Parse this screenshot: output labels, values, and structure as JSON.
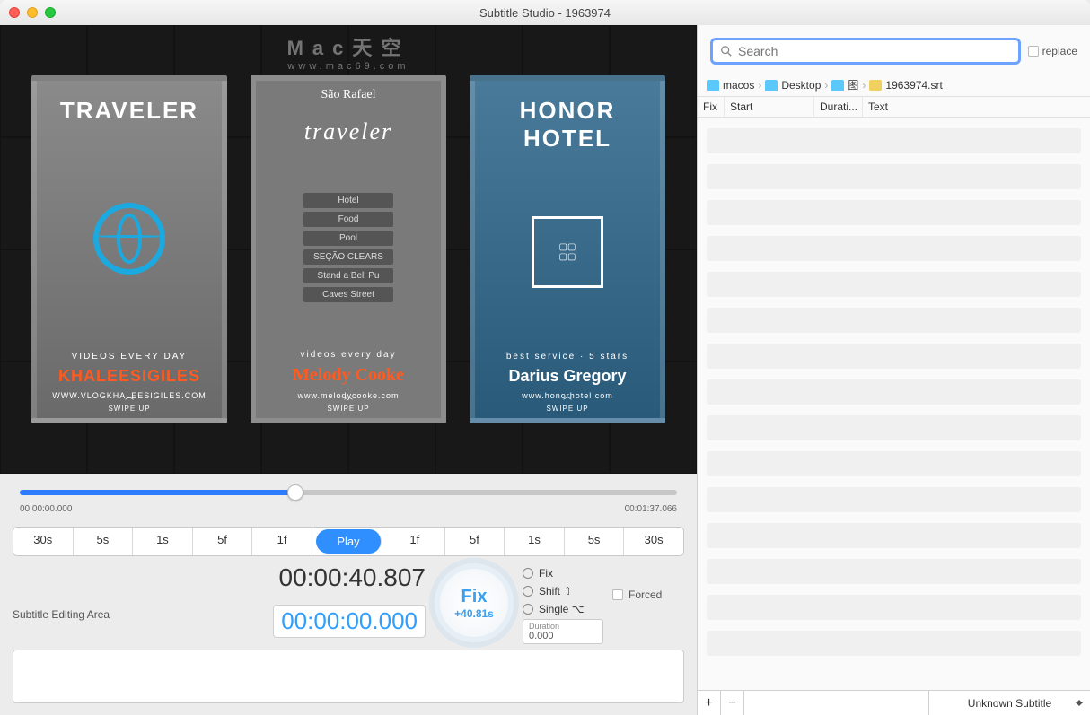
{
  "window": {
    "title": "Subtitle Studio - 1963974"
  },
  "watermark": {
    "line1": "Mac天空",
    "line2": "www.mac69.com"
  },
  "preview": {
    "cards": [
      {
        "title": "TRAVELER",
        "sub": "VIDEOS EVERY DAY",
        "name": "KHALEESIGILES",
        "url": "WWW.VLOGKHALEESIGILES.COM",
        "swipe": "SWIPE UP"
      },
      {
        "title": "traveler",
        "script": "São Rafael",
        "signs": [
          "Hotel",
          "Food",
          "Pool",
          "SEÇÃO CLEARS",
          "Stand a Bell Pu",
          "Caves Street"
        ],
        "sub": "videos every day",
        "name": "Melody Cooke",
        "url": "www.melodycooke.com",
        "swipe": "SWIPE UP"
      },
      {
        "title1": "HONOR",
        "title2": "HOTEL",
        "sub": "best service · 5 stars",
        "name": "Darius Gregory",
        "url": "www.honorhotel.com",
        "swipe": "SWIPE UP"
      }
    ]
  },
  "timeline": {
    "start": "00:00:00.000",
    "end": "00:01:37.066",
    "position_pct": 42
  },
  "seek": {
    "back": [
      "30s",
      "5s",
      "1s",
      "5f",
      "1f"
    ],
    "play": "Play",
    "fwd": [
      "1f",
      "5f",
      "1s",
      "5s",
      "30s"
    ]
  },
  "timecode": {
    "current": "00:00:40.807",
    "edit": "00:00:00.000"
  },
  "fix": {
    "label": "Fix",
    "offset": "+40.81s"
  },
  "modes": {
    "fix": "Fix",
    "shift": "Shift ⇧",
    "single": "Single ⌥"
  },
  "duration": {
    "label": "Duration",
    "value": "0.000"
  },
  "forced": {
    "label": "Forced"
  },
  "subedit": {
    "label": "Subtitle Editing Area"
  },
  "search": {
    "placeholder": "Search",
    "replace": "replace"
  },
  "breadcrumbs": [
    "macos",
    "Desktop",
    "图",
    "1963974.srt"
  ],
  "columns": {
    "fix": "Fix",
    "start": "Start",
    "duration": "Durati...",
    "text": "Text"
  },
  "footer": {
    "subtitle": "Unknown Subtitle"
  }
}
